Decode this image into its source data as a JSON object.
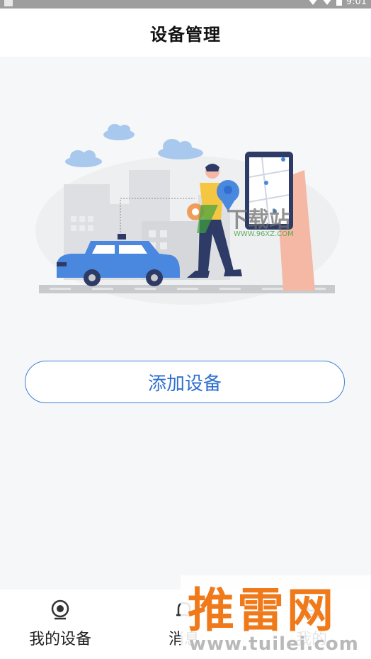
{
  "status_bar": {
    "time": "9:01"
  },
  "header": {
    "title": "设备管理"
  },
  "main": {
    "add_device_label": "添加设备"
  },
  "bottom_nav": {
    "items": [
      {
        "label": "我的设备",
        "icon": "camera-icon"
      },
      {
        "label": "消息",
        "icon": "bell-icon"
      },
      {
        "label": "我的",
        "icon": "person-icon"
      }
    ]
  },
  "watermarks": {
    "center_brand": "下载站",
    "center_url": "WWW.96XZ.COM",
    "corner_brand": "推雷网",
    "corner_url": "www.tuilei.com"
  },
  "colors": {
    "accent": "#3f7fd6",
    "watermark_orange": "#f07a1a",
    "car_blue": "#4a88e0"
  }
}
